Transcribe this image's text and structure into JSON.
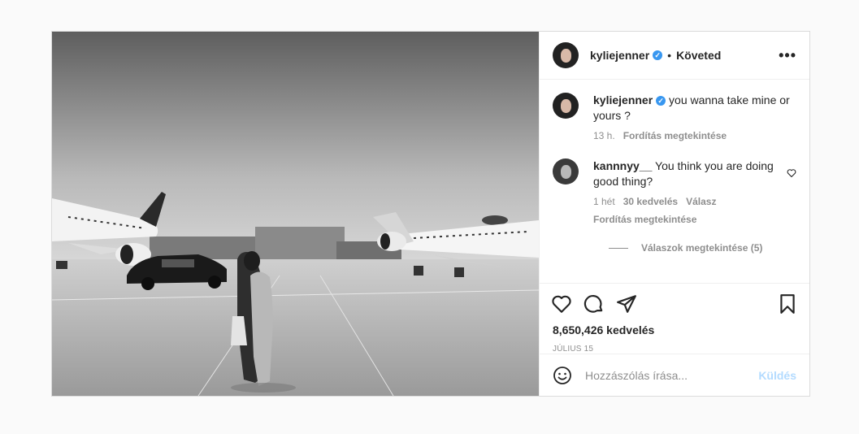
{
  "post": {
    "author": "kyliejenner",
    "separator": "•",
    "follow_status": "Követed",
    "more_icon": "more-horizontal-icon"
  },
  "caption": {
    "author": "kyliejenner",
    "text": "you wanna take mine or yours ?",
    "time": "13 h.",
    "translate": "Fordítás megtekintése"
  },
  "comment": {
    "author": "kannnyy__",
    "text": "You think you are doing good thing?",
    "time": "1 hét",
    "likes": "30 kedvelés",
    "reply": "Válasz",
    "translate": "Fordítás megtekintése",
    "view_replies": "Válaszok megtekintése (5)"
  },
  "stats": {
    "likes": "8,650,426 kedvelés",
    "date": "JÚLIUS 15"
  },
  "composer": {
    "placeholder": "Hozzászólás írása...",
    "send": "Küldés"
  },
  "colors": {
    "verified": "#3897f0",
    "send_disabled": "#b3dbff",
    "muted": "#8e8e8e"
  }
}
